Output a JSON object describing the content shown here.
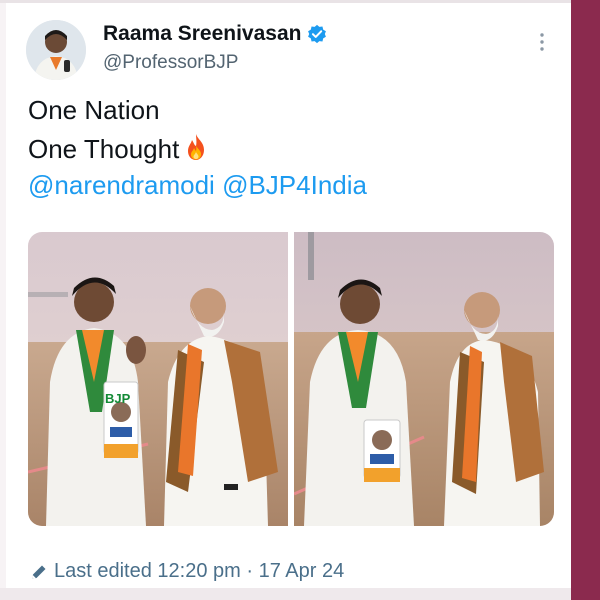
{
  "tweet": {
    "author_name": "Raama Sreenivasan",
    "handle": "@ProfessorBJP",
    "text_line1": "One Nation",
    "text_line2": "One Thought",
    "mentions": [
      "@narendramodi",
      "@BJP4India"
    ],
    "edited_label": "Last edited 12:20 pm · 17 Apr 24",
    "photo_badge_text": "BJP"
  },
  "icons": {
    "verified": "verified-badge-icon",
    "more": "more-options-icon",
    "fire": "fire-emoji-icon",
    "edit": "pencil-icon"
  },
  "colors": {
    "link": "#1d9bf0",
    "verified": "#1d9bf0",
    "frame": "#8b2a4e"
  }
}
